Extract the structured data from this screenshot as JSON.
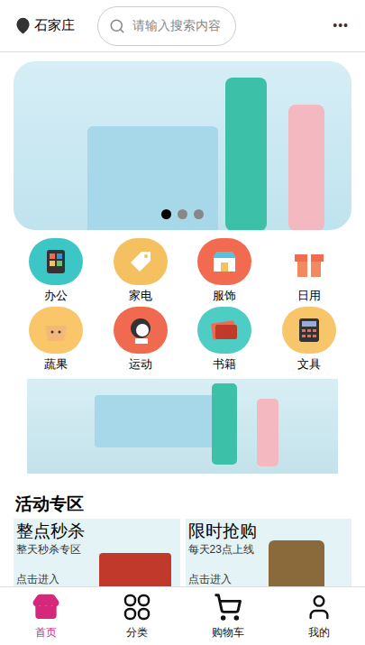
{
  "header": {
    "location": "石家庄",
    "search_placeholder": "请输入搜索内容",
    "more": "•••"
  },
  "banner": {
    "dots": [
      {
        "selected": true
      },
      {
        "selected": false
      },
      {
        "selected": false
      }
    ]
  },
  "categories": [
    {
      "label": "办公",
      "color": "#3cc6c6"
    },
    {
      "label": "家电",
      "color": "#f5c060"
    },
    {
      "label": "服饰",
      "color": "#f26b50"
    },
    {
      "label": "日用",
      "color": "#ffffff"
    },
    {
      "label": "蔬果",
      "color": "#f9c66a"
    },
    {
      "label": "运动",
      "color": "#f06a50"
    },
    {
      "label": "书籍",
      "color": "#4ecdc4"
    },
    {
      "label": "文具",
      "color": "#f7c66a"
    }
  ],
  "section": {
    "title": "活动专区"
  },
  "cards": [
    {
      "title": "整点秒杀",
      "subtitle": "整天秒杀专区",
      "action": "点击进入"
    },
    {
      "title": "限时抢购",
      "subtitle": "每天23点上线",
      "action": "点击进入"
    }
  ],
  "tabs": [
    {
      "label": "首页",
      "selected": true
    },
    {
      "label": "分类",
      "selected": false
    },
    {
      "label": "购物车",
      "selected": false
    },
    {
      "label": "我的",
      "selected": false
    }
  ]
}
